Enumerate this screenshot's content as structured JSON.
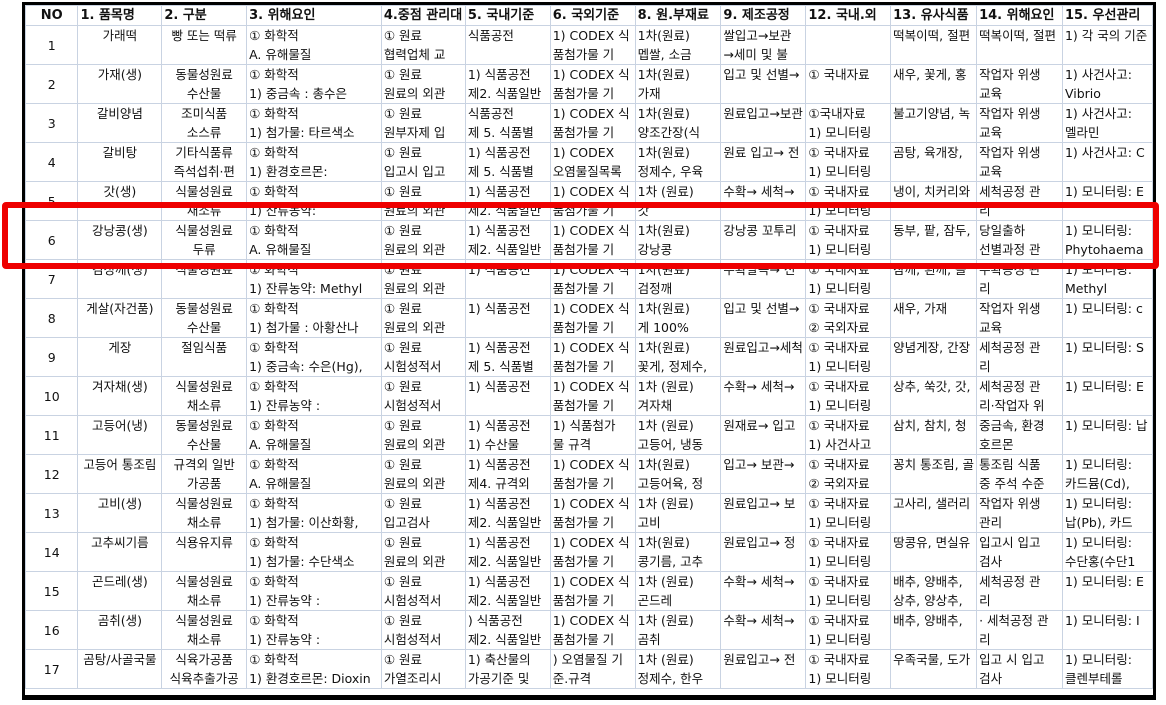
{
  "headers": [
    "NO",
    "1. 품목명",
    "2. 구분",
    "3. 위해요인",
    "4.중점 관리대",
    "5. 국내기준",
    "6. 국외기준",
    "8. 원.부재료",
    "9. 제조공정",
    "12. 국내.외",
    "13. 유사식품",
    "14. 위해요인",
    "15. 우선관리"
  ],
  "rows": [
    {
      "no": "1",
      "c1": [
        "가래떡",
        ""
      ],
      "c2": [
        "빵 또는 떡류",
        ""
      ],
      "c3": [
        "① 화학적",
        "A. 유해물질"
      ],
      "c4": [
        "① 원료",
        "협력업체 교"
      ],
      "c5": [
        "식품공전",
        ""
      ],
      "c6": [
        "1) CODEX 식",
        "품첨가물 기"
      ],
      "c8": [
        "1차(원료)",
        "멥쌀, 소금"
      ],
      "c9": [
        "쌀입고→보관",
        "→세미 및 불"
      ],
      "c12": [
        "",
        ""
      ],
      "c13": [
        "떡복이떡, 절편",
        ""
      ],
      "c14": [
        "떡복이떡, 절편",
        ""
      ],
      "c15": [
        "1) 각 국의 기준",
        ""
      ]
    },
    {
      "no": "2",
      "c1": [
        "가재(생)",
        ""
      ],
      "c2": [
        "동물성원료",
        "수산물"
      ],
      "c3": [
        "① 화학적",
        "1) 중금속 : 총수은"
      ],
      "c4": [
        "① 원료",
        "원료의 외관"
      ],
      "c5": [
        "1) 식품공전",
        "제2. 식품일반"
      ],
      "c6": [
        "1) CODEX 식",
        "품첨가물 기"
      ],
      "c8": [
        "1차(원료)",
        "가재"
      ],
      "c9": [
        "입고 및 선별→",
        ""
      ],
      "c12": [
        "① 국내자료",
        ""
      ],
      "c13": [
        "새우, 꽃게, 홍",
        ""
      ],
      "c14": [
        "작업자 위생",
        "교육"
      ],
      "c15": [
        "1) 사건사고:",
        "Vibrio"
      ]
    },
    {
      "no": "3",
      "c1": [
        "갈비양념",
        ""
      ],
      "c2": [
        "조미식품",
        "소스류"
      ],
      "c3": [
        "① 화학적",
        " 1) 첨가물: 타르색소"
      ],
      "c4": [
        "① 원료",
        "원부자제 입"
      ],
      "c5": [
        "식품공전",
        "제 5. 식품별"
      ],
      "c6": [
        "1) CODEX 식",
        "품첨가물 기"
      ],
      "c8": [
        "1차(원료)",
        "양조간장(식"
      ],
      "c9": [
        "원료입고→보관",
        ""
      ],
      "c12": [
        "①국내자료",
        "1) 모니터링"
      ],
      "c13": [
        "불고기양념, 녹",
        ""
      ],
      "c14": [
        "작업자 위생",
        "교육"
      ],
      "c15": [
        "1) 사건사고:",
        "멜라민"
      ]
    },
    {
      "no": "4",
      "c1": [
        "갈비탕",
        ""
      ],
      "c2": [
        "기타식품류",
        "즉석섭취·편"
      ],
      "c3": [
        "① 화학적",
        "1) 환경호르몬:"
      ],
      "c4": [
        "① 원료",
        "입고시 입고"
      ],
      "c5": [
        "1) 식품공전",
        "제 5. 식품별"
      ],
      "c6": [
        "1) CODEX",
        "오염물질목록"
      ],
      "c8": [
        "1차(원료)",
        "정제수, 우육"
      ],
      "c9": [
        "원료 입고→ 전",
        ""
      ],
      "c12": [
        "① 국내자료",
        "1) 모니터링"
      ],
      "c13": [
        "곰탕, 육개장,",
        ""
      ],
      "c14": [
        "작업자 위생",
        "교육"
      ],
      "c15": [
        "1) 사건사고: C",
        ""
      ]
    },
    {
      "no": "5",
      "c1": [
        "갓(생)",
        ""
      ],
      "c2": [
        "식물성원료",
        "채소류"
      ],
      "c3": [
        "① 화학적",
        "1) 잔류농약:"
      ],
      "c4": [
        "① 원료",
        "원료의 외관"
      ],
      "c5": [
        "1) 식품공전",
        "제2. 식품일반"
      ],
      "c6": [
        "1) CODEX 식",
        "품첨가물 기"
      ],
      "c8": [
        "1차 (원료)",
        "갓"
      ],
      "c9": [
        "수확→ 세척→",
        ""
      ],
      "c12": [
        "① 국내자료",
        "1) 모니터링"
      ],
      "c13": [
        "냉이, 치커리와",
        ""
      ],
      "c14": [
        "세척공정 관",
        "리"
      ],
      "c15": [
        "1) 모니터링: E",
        ""
      ]
    },
    {
      "no": "6",
      "c1": [
        "강낭콩(생)",
        ""
      ],
      "c2": [
        "식물성원료",
        "두류"
      ],
      "c3": [
        "① 화학적",
        "A. 유해물질"
      ],
      "c4": [
        "① 원료",
        "원료의 외관"
      ],
      "c5": [
        "1) 식품공전",
        "제2. 식품일반"
      ],
      "c6": [
        "1) CODEX 식",
        "품첨가물 기"
      ],
      "c8": [
        "1차(원료)",
        "강낭콩"
      ],
      "c9": [
        "강낭콩 꼬투리",
        ""
      ],
      "c12": [
        "① 국내자료",
        "1) 모니터링"
      ],
      "c13": [
        "동부, 팥, 잠두,",
        ""
      ],
      "c14": [
        "당일출하",
        "선별과정 관"
      ],
      "c15": [
        "1) 모니터링:",
        "Phytohaema"
      ]
    },
    {
      "no": "7",
      "c1": [
        "검정깨(생)",
        ""
      ],
      "c2": [
        "식물성원료",
        ""
      ],
      "c3": [
        "① 화학적",
        "1) 잔류농약: Methyl"
      ],
      "c4": [
        "① 원료",
        "원료의 외관"
      ],
      "c5": [
        "1) 식품공전",
        ""
      ],
      "c6": [
        "1) CODEX 식",
        "품첨가물 기"
      ],
      "c8": [
        "1차(원료)",
        "검정깨"
      ],
      "c9": [
        "수확탈곡→ 선",
        ""
      ],
      "c12": [
        "① 국내자료",
        "1) 모니터링"
      ],
      "c13": [
        "참깨, 흰깨, 들",
        ""
      ],
      "c14": [
        "수확공정 관",
        "리"
      ],
      "c15": [
        "1) 모니터링:",
        "Methyl"
      ]
    },
    {
      "no": "8",
      "c1": [
        "게살(자건품)",
        ""
      ],
      "c2": [
        "동물성원료",
        "수산물"
      ],
      "c3": [
        "① 화학적",
        "1) 첨가물 :  아황산나"
      ],
      "c4": [
        "① 원료",
        "원료의 외관"
      ],
      "c5": [
        "1) 식품공전",
        ""
      ],
      "c6": [
        "1) CODEX 식",
        "품첨가물 기"
      ],
      "c8": [
        "1차(원료)",
        "게 100%"
      ],
      "c9": [
        "입고 및 선별→",
        ""
      ],
      "c12": [
        "① 국내자료",
        "② 국외자료"
      ],
      "c13": [
        "새우, 가재",
        ""
      ],
      "c14": [
        "작업자 위생",
        "교육"
      ],
      "c15": [
        "1) 모니터링: c",
        ""
      ]
    },
    {
      "no": "9",
      "c1": [
        "게장",
        ""
      ],
      "c2": [
        "절임식품",
        ""
      ],
      "c3": [
        "① 화학적",
        "1) 중금속: 수은(Hg),"
      ],
      "c4": [
        "① 원료",
        "시험성적서"
      ],
      "c5": [
        "1) 식품공전",
        "제 5. 식품별"
      ],
      "c6": [
        "1) CODEX 식",
        "품첨가물 기"
      ],
      "c8": [
        "1차(원료)",
        "꽃게, 정제수,"
      ],
      "c9": [
        "원료입고→세척",
        ""
      ],
      "c12": [
        "① 국내자료",
        "1) 모니터링"
      ],
      "c13": [
        "양념게장, 간장",
        ""
      ],
      "c14": [
        "세척공정 관",
        "리"
      ],
      "c15": [
        "1) 모니터링: S",
        ""
      ]
    },
    {
      "no": "10",
      "c1": [
        "겨자채(생)",
        ""
      ],
      "c2": [
        "식물성원료",
        "채소류"
      ],
      "c3": [
        "① 화학적",
        "1) 잔류농약 :"
      ],
      "c4": [
        "① 원료",
        "시험성적서"
      ],
      "c5": [
        "1) 식품공전",
        ""
      ],
      "c6": [
        "1) CODEX 식",
        "품첨가물 기"
      ],
      "c8": [
        "1차 (원료)",
        "겨자채"
      ],
      "c9": [
        "수확→ 세척→",
        ""
      ],
      "c12": [
        "① 국내자료",
        "1) 모니터링"
      ],
      "c13": [
        "상추, 쑥갓, 갓,",
        ""
      ],
      "c14": [
        "세척공정 관",
        "리·작업자 위"
      ],
      "c15": [
        "1) 모니터링: E",
        ""
      ]
    },
    {
      "no": "11",
      "c1": [
        "고등어(냉)",
        ""
      ],
      "c2": [
        "동물성원료",
        "수산물"
      ],
      "c3": [
        "① 화학적",
        "A. 유해물질"
      ],
      "c4": [
        "① 원료",
        "원료의 외관"
      ],
      "c5": [
        "1) 식품공전",
        "1) 수산물"
      ],
      "c6": [
        "1) 식품첨가",
        "물 규격"
      ],
      "c8": [
        "1차 (원료)",
        "고등어, 냉동"
      ],
      "c9": [
        "원재료→ 입고",
        ""
      ],
      "c12": [
        "① 국내자료",
        "1) 사건사고"
      ],
      "c13": [
        "삼치, 참치, 청",
        ""
      ],
      "c14": [
        "중금속, 환경",
        "호르몬"
      ],
      "c15": [
        "1) 모니터링: 납",
        ""
      ]
    },
    {
      "no": "12",
      "c1": [
        "고등어 통조림",
        ""
      ],
      "c2": [
        "규격외 일반",
        "가공품"
      ],
      "c3": [
        "① 화학적",
        "A. 유해물질"
      ],
      "c4": [
        "① 원료",
        "원료의 외관"
      ],
      "c5": [
        "1) 식품공전",
        "제4. 규격외"
      ],
      "c6": [
        "1) CODEX 식",
        "품첨가물 기"
      ],
      "c8": [
        "1차(원료)",
        "고등어육, 정"
      ],
      "c9": [
        "입고→ 보관→",
        ""
      ],
      "c12": [
        "① 국내자료",
        "② 국외자료"
      ],
      "c13": [
        "꽁치 통조림, 골",
        ""
      ],
      "c14": [
        "통조림 식품",
        "중 주석 수준"
      ],
      "c15": [
        "1) 모니터링:",
        "카드뮴(Cd),"
      ]
    },
    {
      "no": "13",
      "c1": [
        "고비(생)",
        ""
      ],
      "c2": [
        "식물성원료",
        "채소류"
      ],
      "c3": [
        "① 화학적",
        "1) 첨가물: 이산화황,"
      ],
      "c4": [
        "① 원료",
        "입고검사"
      ],
      "c5": [
        "1) 식품공전",
        "제2. 식품일반"
      ],
      "c6": [
        "1) CODEX 식",
        "품첨가물 기"
      ],
      "c8": [
        "1차 (원료)",
        "고비"
      ],
      "c9": [
        "원료입고→ 보",
        ""
      ],
      "c12": [
        "① 국내자료",
        "1) 모니터링"
      ],
      "c13": [
        "고사리, 샐러리",
        ""
      ],
      "c14": [
        "작업자 위생",
        "관리"
      ],
      "c15": [
        "1) 모니터링:",
        "납(Pb), 카드"
      ]
    },
    {
      "no": "14",
      "c1": [
        "고추씨기름",
        ""
      ],
      "c2": [
        "식용유지류",
        ""
      ],
      "c3": [
        "① 화학적",
        "1) 첨가물: 수단색소"
      ],
      "c4": [
        "① 원료",
        "원료의 외관"
      ],
      "c5": [
        "1) 식품공전",
        "제2. 식품일반"
      ],
      "c6": [
        "1) CODEX 식",
        "품첨가물 기"
      ],
      "c8": [
        "1차(원료)",
        "콩기름, 고추"
      ],
      "c9": [
        "원료입고→ 정",
        ""
      ],
      "c12": [
        "① 국내자료",
        "1) 모니터링"
      ],
      "c13": [
        "땅콩유, 면실유",
        ""
      ],
      "c14": [
        "입고시 입고",
        "검사"
      ],
      "c15": [
        "1) 모니터링:",
        "수단홍(수단1"
      ]
    },
    {
      "no": "15",
      "c1": [
        "곤드레(생)",
        ""
      ],
      "c2": [
        "식물성원료",
        "채소류"
      ],
      "c3": [
        "① 화학적",
        "1) 잔류농약 :"
      ],
      "c4": [
        "① 원료",
        "시험성적서"
      ],
      "c5": [
        "1) 식품공전",
        "제2. 식품일반"
      ],
      "c6": [
        "1) CODEX 식",
        "품첨가물 기"
      ],
      "c8": [
        "1차 (원료)",
        "곤드레"
      ],
      "c9": [
        "수확→ 세척→",
        ""
      ],
      "c12": [
        "① 국내자료",
        "1) 모니터링"
      ],
      "c13": [
        "배추, 양배추,",
        "상추, 양상추,"
      ],
      "c14": [
        "세척공정 관",
        "리"
      ],
      "c15": [
        "1) 모니터링: E",
        ""
      ]
    },
    {
      "no": "16",
      "c1": [
        "곰취(생)",
        ""
      ],
      "c2": [
        "식물성원료",
        "채소류"
      ],
      "c3": [
        "① 화학적",
        "1) 잔류농약 :"
      ],
      "c4": [
        "① 원료",
        "시험성적서"
      ],
      "c5": [
        ") 식품공전",
        "제2. 식품일반"
      ],
      "c6": [
        "1) CODEX 식",
        "품첨가물 기"
      ],
      "c8": [
        "1차 (원료)",
        "곰취"
      ],
      "c9": [
        "수확→ 세척→",
        ""
      ],
      "c12": [
        "① 국내자료",
        "1) 모니터링"
      ],
      "c13": [
        "배추, 양배추,",
        ""
      ],
      "c14": [
        "· 세척공정 관",
        "리"
      ],
      "c15": [
        "1) 모니터링: I",
        ""
      ]
    },
    {
      "no": "17",
      "c1": [
        "곰탕/사골국물",
        ""
      ],
      "c2": [
        "식육가공품",
        "식육추출가공"
      ],
      "c3": [
        "① 화학적",
        "1) 환경호르몬: Dioxin"
      ],
      "c4": [
        "① 원료",
        "가열조리시"
      ],
      "c5": [
        "1) 축산물의",
        "가공기준 및"
      ],
      "c6": [
        ") 오염물질 기",
        "준.규격"
      ],
      "c8": [
        "1차 (원료)",
        " 정제수, 한우"
      ],
      "c9": [
        "원료입고→ 전",
        ""
      ],
      "c12": [
        "① 국내자료",
        "1) 모니터링"
      ],
      "c13": [
        "우족국물, 도가",
        ""
      ],
      "c14": [
        "입고 시 입고",
        "검사"
      ],
      "c15": [
        "1) 모니터링:",
        "클렌부테롤"
      ]
    }
  ],
  "highlight": {
    "row_no": "6",
    "color": "#ee0000"
  }
}
